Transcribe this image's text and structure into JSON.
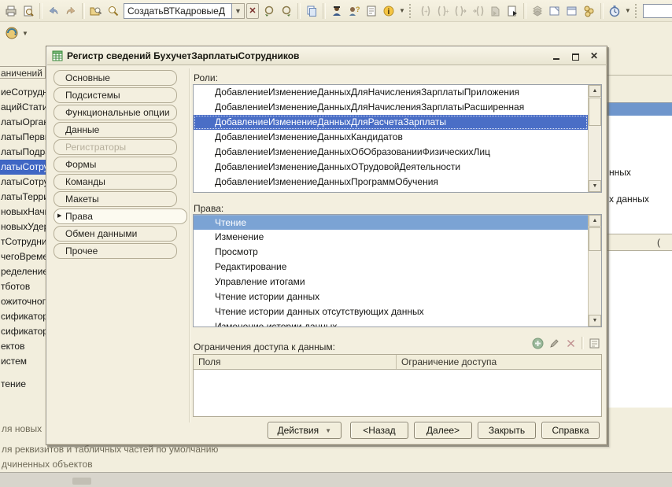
{
  "toolbar": {
    "combo_value": "СоздатьВТКадровыеД",
    "quick_input_value": "",
    "icons_row1": [
      "print-icon",
      "print-preview-icon",
      "undo-icon",
      "redo-icon",
      "find-in-tree-icon",
      "find-icon",
      "combo-dropdown-icon",
      "combo-clear-icon",
      "search-back-icon",
      "search-forward-icon",
      "copy-icon",
      "user-icon",
      "syntax-helper-icon",
      "document-icon",
      "info-icon",
      "proc-begin-icon",
      "proc-end-icon",
      "func-begin-icon",
      "goto-proc-icon",
      "merge-module-icon",
      "module-run-icon",
      "stack-icon",
      "open-module-icon",
      "open-form-icon",
      "chain-icon",
      "timer-icon"
    ],
    "icons_row2": [
      "web-service-icon"
    ]
  },
  "background": {
    "panel_header": "аничений",
    "tree_selected_index": 5,
    "tree_items": [
      "иеСотрудни",
      "ацийСтатис",
      "латыОрган",
      "латыПерви",
      "латыПодра",
      "латыСотру",
      "латыСотру",
      "латыТерри",
      "новыхНачис",
      "новыхУдерж",
      "тСотрудник",
      "чегоВреме",
      "ределение",
      "тботов",
      "ожиточного",
      "сификатор",
      "сификатор",
      "ектов",
      "истем",
      "",
      "тение"
    ],
    "right_fragments": {
      "f1": "нных",
      "f2": "х данных",
      "f3": "("
    },
    "bottom_lines": {
      "l1": "ля новых о",
      "l2": "ля реквизитов и табличных частей по умолчанию",
      "l3": "дчиненных объектов"
    }
  },
  "dialog": {
    "title": "Регистр сведений БухучетЗарплатыСотрудников",
    "tabs": [
      {
        "label": "Основные"
      },
      {
        "label": "Подсистемы"
      },
      {
        "label": "Функциональные опции"
      },
      {
        "label": "Данные"
      },
      {
        "label": "Регистраторы",
        "state": "disabled"
      },
      {
        "label": "Формы"
      },
      {
        "label": "Команды"
      },
      {
        "label": "Макеты"
      },
      {
        "label": "Права",
        "state": "selected"
      },
      {
        "label": "Обмен данными"
      },
      {
        "label": "Прочее"
      }
    ],
    "roles_label": "Роли:",
    "roles_selected_index": 2,
    "roles": [
      "ДобавлениеИзменениеДанныхДляНачисленияЗарплатыПриложения",
      "ДобавлениеИзменениеДанныхДляНачисленияЗарплатыРасширенная",
      "ДобавлениеИзменениеДанныхДляРасчетаЗарплаты",
      "ДобавлениеИзменениеДанныхКандидатов",
      "ДобавлениеИзменениеДанныхОбОбразованииФизическихЛиц",
      "ДобавлениеИзменениеДанныхОТрудовойДеятельности",
      "ДобавлениеИзменениеДанныхПрограммОбучения"
    ],
    "rights_label": "Права:",
    "rights_selected_index": 0,
    "rights": [
      "Чтение",
      "Изменение",
      "Просмотр",
      "Редактирование",
      "Управление итогами",
      "Чтение истории данных",
      "Чтение истории данных отсутствующих данных",
      "Изменение истории данных"
    ],
    "restrictions": {
      "label": "Ограничения доступа к данным:",
      "columns": {
        "c1": "Поля",
        "c2": "Ограничение доступа"
      },
      "icons": [
        "add-icon",
        "edit-icon",
        "delete-icon",
        "template-icon"
      ]
    },
    "buttons": {
      "actions": "Действия",
      "back": "<Назад",
      "next": "Далее>",
      "close": "Закрыть",
      "help": "Справка"
    }
  },
  "colors": {
    "selection_active": "#4a6ec6",
    "selection_inactive": "#7ba3d4",
    "window_bg": "#f2eedd",
    "list_bg": "#ffffff"
  }
}
